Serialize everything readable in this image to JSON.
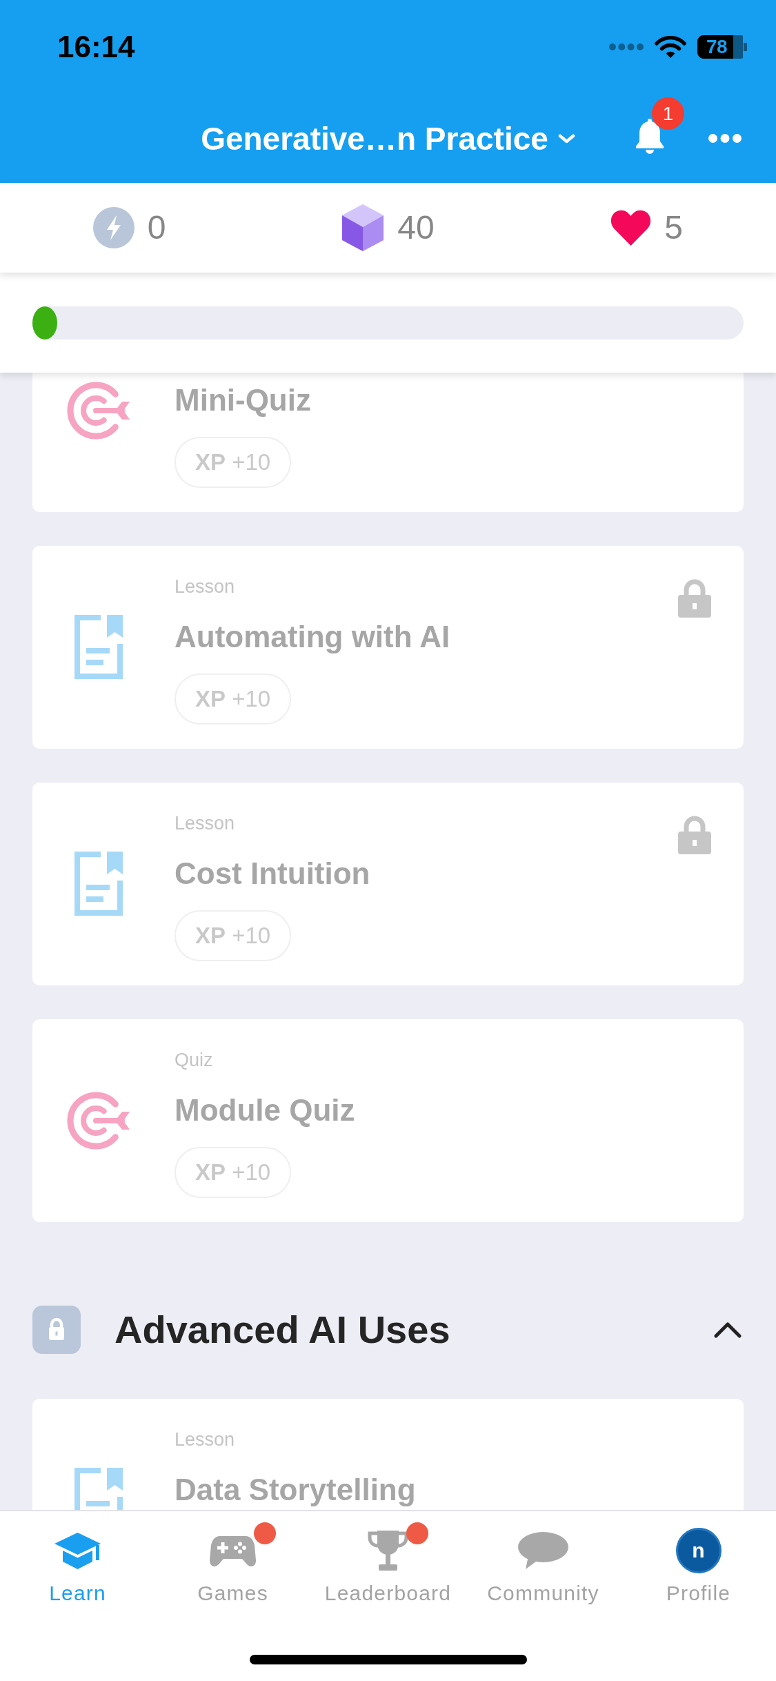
{
  "status_bar": {
    "time": "16:14",
    "battery": "78"
  },
  "header": {
    "title": "Generative…n Practice",
    "notification_count": "1"
  },
  "stats": [
    {
      "kind": "streak",
      "value": "0"
    },
    {
      "kind": "gems",
      "value": "40"
    },
    {
      "kind": "hearts",
      "value": "5"
    }
  ],
  "progress": {
    "level": 0.035
  },
  "modules": [
    {
      "lessons": [
        {
          "kind": "quiz",
          "title": "Mini-Quiz",
          "xp": "**XP** +10",
          "locked": false
        },
        {
          "kind": "lesson",
          "type": "Lesson",
          "title": "Automating with AI",
          "xp": "**XP** +10",
          "locked": true
        },
        {
          "kind": "lesson",
          "type": "Lesson",
          "title": "Cost Intuition",
          "xp": "**XP** +10",
          "locked": true
        },
        {
          "kind": "quiz",
          "type": "Quiz",
          "title": "Module Quiz",
          "xp": "**XP** +10",
          "locked": false
        }
      ]
    },
    {
      "title": "Advanced AI Uses",
      "locked": true,
      "expanded": true,
      "lessons": [
        {
          "kind": "lesson",
          "type": "Lesson",
          "title": "Data Storytelling",
          "locked": false
        }
      ]
    }
  ],
  "tab_bar": [
    {
      "kind": "learn",
      "label": "Learn",
      "selected": true,
      "badge": false
    },
    {
      "kind": "games",
      "label": "Games",
      "selected": false,
      "badge": true
    },
    {
      "kind": "leaderboard",
      "label": "Leaderboard",
      "selected": false,
      "badge": true
    },
    {
      "kind": "community",
      "label": "Community",
      "selected": false,
      "badge": false
    },
    {
      "kind": "profile",
      "label": "Profile",
      "selected": false,
      "badge": false,
      "avatar": "n"
    }
  ]
}
